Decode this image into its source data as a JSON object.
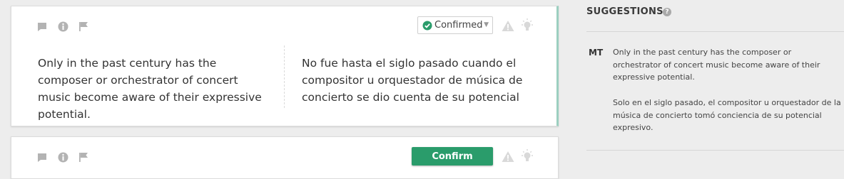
{
  "segments": [
    {
      "source": "Only in the past century has the composer or orchestrator of concert music become aware of their expressive potential.",
      "target": "No fue hasta el siglo pasado cuando el compositor u orquestador de música de concierto se dio cuenta de su potencial",
      "status": "Confirmed",
      "status_icon": "check-circle-icon"
    },
    {
      "button": "Confirm"
    }
  ],
  "suggestions": {
    "title": "SUGGESTIONS",
    "help": "?",
    "label": "MT",
    "original": "Only in the past century has the composer or orchestrator of concert music become aware of their expressive potential.",
    "translation": "Solo en el siglo pasado, el compositor u orquestador de la música de concierto tomó conciencia de su potencial expresivo."
  },
  "colors": {
    "confirm_button": "#2a9c6b",
    "confirmed_check": "#2a9c6b",
    "active_segment_bar": "#9ccfc0",
    "icon_gray": "#b3b3b3"
  }
}
